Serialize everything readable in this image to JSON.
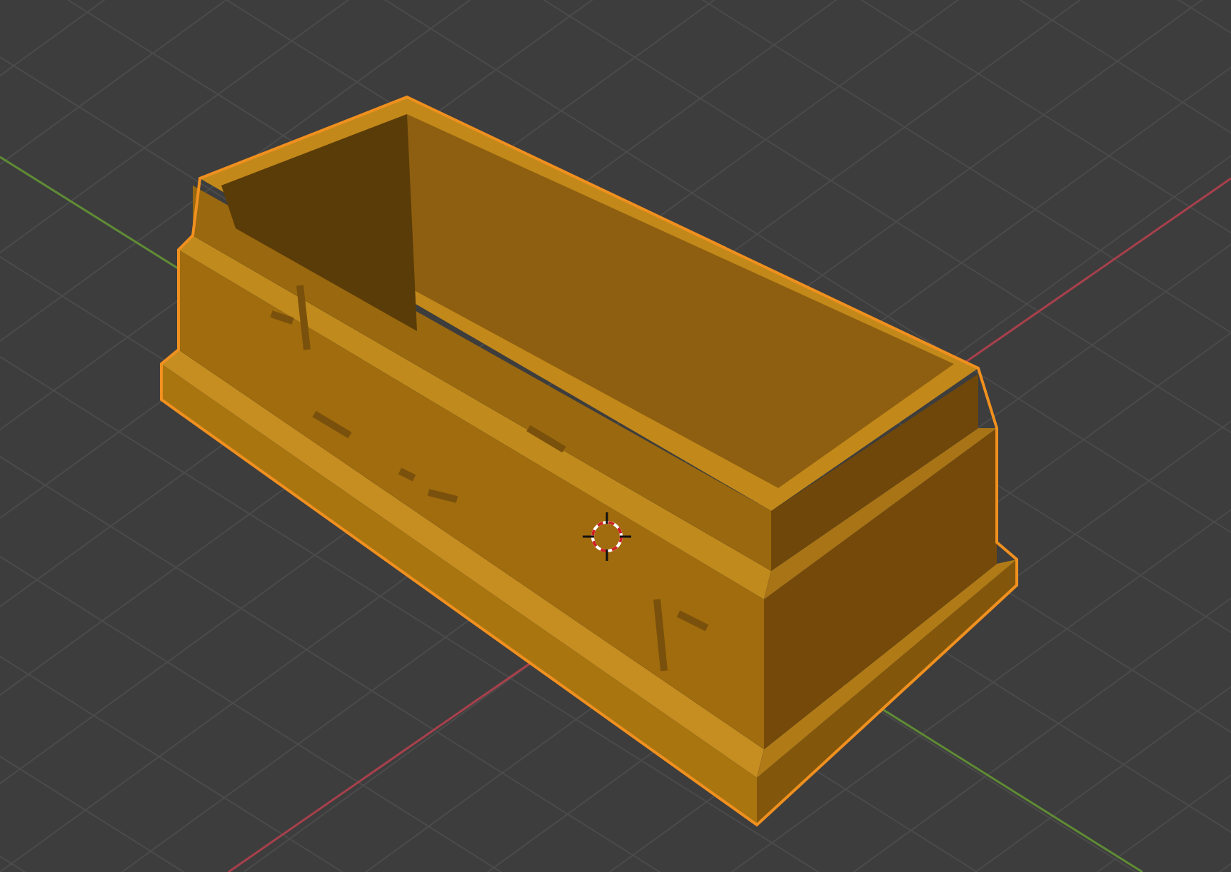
{
  "viewport": {
    "axes": [
      {
        "kind": "x",
        "color": "#a8404c"
      },
      {
        "kind": "y",
        "color": "#5f8c34"
      }
    ],
    "object": {
      "selected": true
    },
    "cursor": {
      "kind": "crosshair"
    }
  }
}
